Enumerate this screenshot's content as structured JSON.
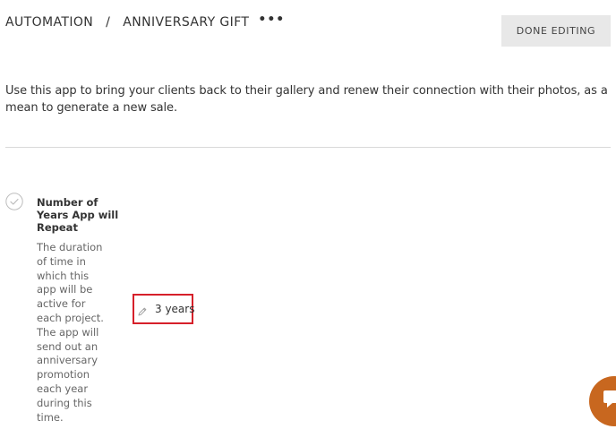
{
  "header": {
    "breadcrumb_root": "AUTOMATION",
    "breadcrumb_separator": "/",
    "breadcrumb_current": "ANNIVERSARY GIFT",
    "more_label": "•••",
    "done_label": "DONE EDITING"
  },
  "description": "Use this app to bring your clients back to their gallery and renew their connection with their photos, as a mean to generate a new sale.",
  "setting": {
    "title": "Number of Years App will Repeat",
    "description": "The duration of time in which this app will be active for each project. The app will send out an anniversary promotion each year during this time.",
    "value": "3 years",
    "status_icon": "check-circle-icon",
    "edit_icon": "pencil-icon"
  },
  "chat": {
    "icon": "chat-icon"
  },
  "colors": {
    "highlight": "#d6202a",
    "chat_bubble": "#c8671f",
    "button_bg": "#e8e8e8"
  }
}
